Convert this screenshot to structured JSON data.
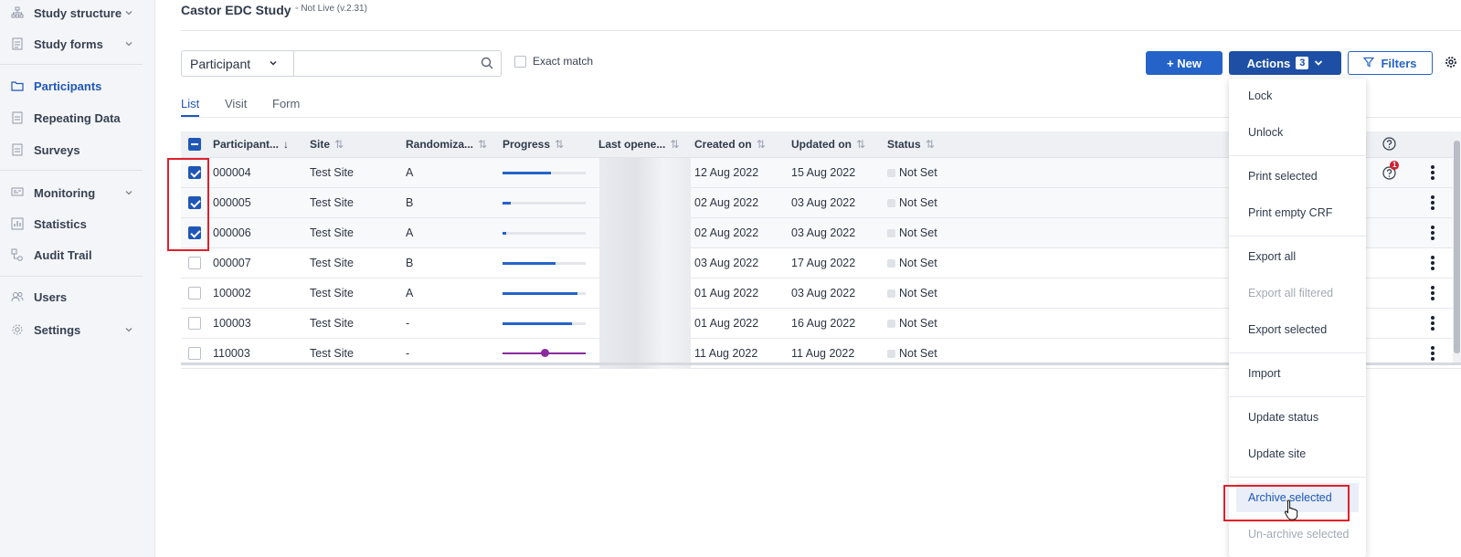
{
  "sidebar": {
    "items": [
      {
        "label": "Study structure",
        "has_chevron": true,
        "icon": "sitemap-icon"
      },
      {
        "label": "Study forms",
        "has_chevron": true,
        "icon": "form-icon"
      },
      {
        "label": "Participants",
        "active": true,
        "icon": "folder-icon"
      },
      {
        "label": "Repeating Data",
        "icon": "document-icon"
      },
      {
        "label": "Surveys",
        "icon": "document-icon"
      },
      {
        "label": "Monitoring",
        "has_chevron": true,
        "icon": "monitor-icon"
      },
      {
        "label": "Statistics",
        "icon": "bar-chart-icon"
      },
      {
        "label": "Audit Trail",
        "icon": "audit-icon"
      },
      {
        "label": "Users",
        "icon": "users-icon"
      },
      {
        "label": "Settings",
        "has_chevron": true,
        "icon": "gear-icon"
      }
    ]
  },
  "header": {
    "title": "Castor EDC Study",
    "status": "◦ Not Live (v.2.31)"
  },
  "search": {
    "field_select": "Participant",
    "placeholder": "",
    "exact_match_label": "Exact match"
  },
  "toolbar": {
    "new_label": "+ New",
    "actions_label": "Actions",
    "actions_count": "3",
    "filters_label": "Filters"
  },
  "tabs": [
    {
      "label": "List",
      "active": true
    },
    {
      "label": "Visit"
    },
    {
      "label": "Form"
    }
  ],
  "table": {
    "columns": [
      "Participant...",
      "Site",
      "Randomiza...",
      "Progress",
      "Last opene...",
      "Created on",
      "Updated on",
      "Status"
    ],
    "sort_active_arrow": "↓",
    "sort_arrow": "⇅",
    "rows": [
      {
        "id": "000004",
        "site": "Test Site",
        "rand": "A",
        "progress": 0.58,
        "created": "12 Aug 2022",
        "updated": "15 Aug 2022",
        "status": "Not Set",
        "selected": true
      },
      {
        "id": "000005",
        "site": "Test Site",
        "rand": "B",
        "progress": 0.1,
        "created": "02 Aug 2022",
        "updated": "03 Aug 2022",
        "status": "Not Set",
        "selected": true
      },
      {
        "id": "000006",
        "site": "Test Site",
        "rand": "A",
        "progress": 0.04,
        "created": "02 Aug 2022",
        "updated": "03 Aug 2022",
        "status": "Not Set",
        "selected": true
      },
      {
        "id": "000007",
        "site": "Test Site",
        "rand": "B",
        "progress": 0.64,
        "created": "03 Aug 2022",
        "updated": "17 Aug 2022",
        "status": "Not Set",
        "selected": false
      },
      {
        "id": "100002",
        "site": "Test Site",
        "rand": "A",
        "progress": 0.9,
        "created": "01 Aug 2022",
        "updated": "03 Aug 2022",
        "status": "Not Set",
        "selected": false
      },
      {
        "id": "100003",
        "site": "Test Site",
        "rand": "-",
        "progress": 0.83,
        "created": "01 Aug 2022",
        "updated": "16 Aug 2022",
        "status": "Not Set",
        "selected": false
      },
      {
        "id": "110003",
        "site": "Test Site",
        "rand": "-",
        "progress": null,
        "created": "11 Aug 2022",
        "updated": "11 Aug 2022",
        "status": "Not Set",
        "selected": false
      }
    ]
  },
  "query_badge_count": "1",
  "actions_menu": {
    "items": [
      {
        "label": "Lock"
      },
      {
        "label": "Unlock"
      },
      {
        "label": "Print selected"
      },
      {
        "label": "Print empty CRF"
      },
      {
        "label": "Export all"
      },
      {
        "label": "Export all filtered",
        "disabled": true
      },
      {
        "label": "Export selected"
      },
      {
        "label": "Import"
      },
      {
        "label": "Update status"
      },
      {
        "label": "Update site"
      },
      {
        "label": "Archive selected",
        "hover": true
      },
      {
        "label": "Un-archive selected",
        "disabled": true
      }
    ]
  },
  "colors": {
    "primary": "#2563c8",
    "primary_dark": "#1e4fa5",
    "highlight": "#e0202a",
    "error_badge": "#d01f2f",
    "archived_progress": "#8a2a9e"
  }
}
